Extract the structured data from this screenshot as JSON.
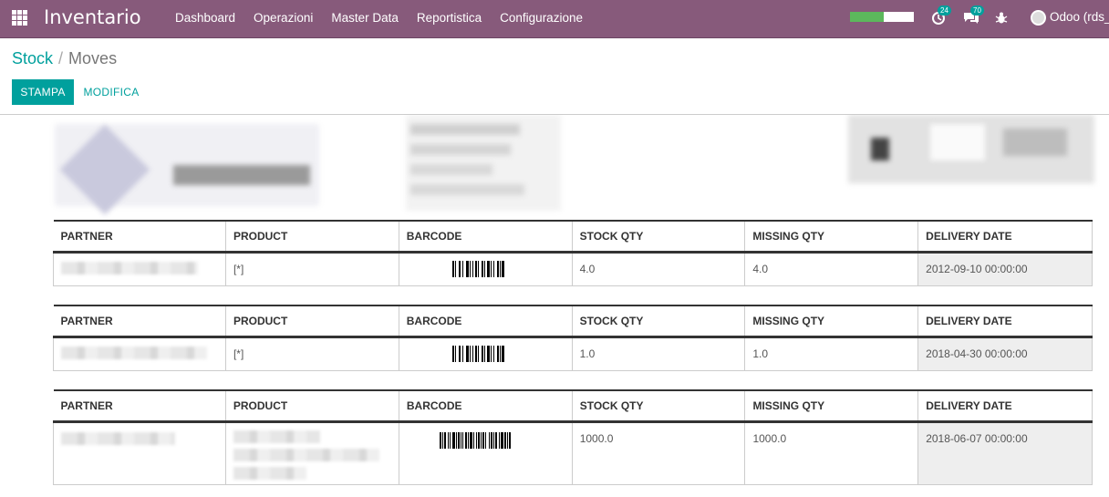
{
  "navbar": {
    "brand": "Inventario",
    "menu": [
      "Dashboard",
      "Operazioni",
      "Master Data",
      "Reportistica",
      "Configurazione"
    ],
    "progress": 0.53,
    "activity_badge": "24",
    "messages_badge": "70",
    "user_name": "Odoo (rds_p"
  },
  "breadcrumb": {
    "parent": "Stock",
    "current": "Moves"
  },
  "buttons": {
    "print": "STAMPA",
    "edit": "MODIFICA"
  },
  "columns": [
    "PARTNER",
    "PRODUCT",
    "BARCODE",
    "STOCK QTY",
    "MISSING QTY",
    "DELIVERY DATE"
  ],
  "rows": [
    {
      "product": "[*]",
      "stock_qty": "4.0",
      "missing_qty": "4.0",
      "delivery_date": "2012-09-10 00:00:00"
    },
    {
      "product": "[*]",
      "stock_qty": "1.0",
      "missing_qty": "1.0",
      "delivery_date": "2018-04-30 00:00:00"
    },
    {
      "product": "",
      "stock_qty": "1000.0",
      "missing_qty": "1000.0",
      "delivery_date": "2018-06-07 00:00:00"
    }
  ],
  "colors": {
    "navbar": "#875a7b",
    "accent": "#00a09d"
  }
}
